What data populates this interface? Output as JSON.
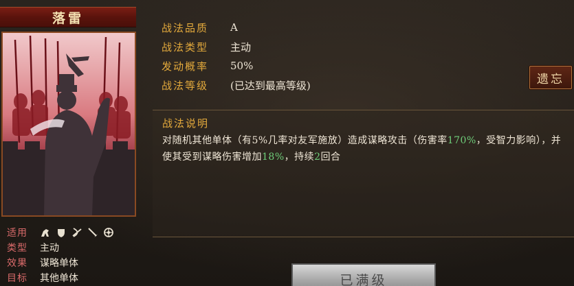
{
  "skill": {
    "name": "落雷",
    "quality_label": "战法品质",
    "quality": "A",
    "type_label": "战法类型",
    "type": "主动",
    "chance_label": "发动概率",
    "chance": "50%",
    "level_label": "战法等级",
    "level": "(已达到最高等级)"
  },
  "attributes": {
    "troops_label": "适用",
    "troop_icons": [
      "cavalry-icon",
      "shield-icon",
      "archer-icon",
      "spear-icon",
      "siege-icon"
    ],
    "type_label": "类型",
    "type": "主动",
    "effect_label": "效果",
    "effect": "谋略单体",
    "target_label": "目标",
    "target": "其他单体"
  },
  "description": {
    "title": "战法说明",
    "part1": "对随机其他单体（有5%几率对友军施放）造成谋略攻击（伤害率",
    "rate": "170%",
    "part2": "，受智力影响），并使其受到谋略伤害增加",
    "increase": "18%",
    "part3": "，持续",
    "duration": "2",
    "part4": "回合"
  },
  "buttons": {
    "forget": "遗忘",
    "maxed": "已满级"
  },
  "colors": {
    "label_gold": "#e4aa3c",
    "label_red": "#d96a6a",
    "highlight_green": "#6fce7a",
    "banner_red": "#7a1e14"
  }
}
